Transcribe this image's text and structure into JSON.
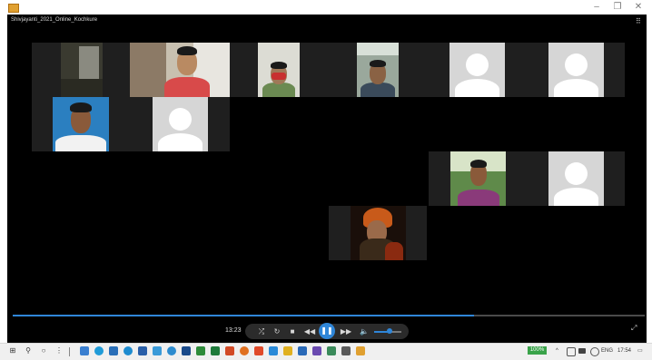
{
  "window": {
    "title": "Shivjayanti_2021_Online_Kochkure",
    "minimize_glyph": "–",
    "maximize_glyph": "❐",
    "close_glyph": "✕",
    "grid_glyph": "⠿"
  },
  "player": {
    "time": "13:23",
    "progress": 0.73,
    "volume": 0.55,
    "controls": {
      "shuffle": "⤮",
      "repeat": "↻",
      "stop": "■",
      "previous": "◀◀",
      "play_pause": "❚❚",
      "next": "▶▶",
      "volume": "🔈",
      "fullscreen": "⤢"
    }
  },
  "taskbar": {
    "start_glyph": "⊞",
    "search_glyph": "⚲",
    "taskview_glyph": "○",
    "divider_glyph": "⋮",
    "badge": "100%",
    "language": "ENG",
    "clock": "17:54",
    "tray_glyph": "^",
    "notification_glyph": "▭"
  },
  "colors": {
    "accent": "#2f86d8",
    "player_bg": "#000000",
    "tile_band": "#1f1f1f",
    "avatar_bg": "#d6d6d6"
  }
}
